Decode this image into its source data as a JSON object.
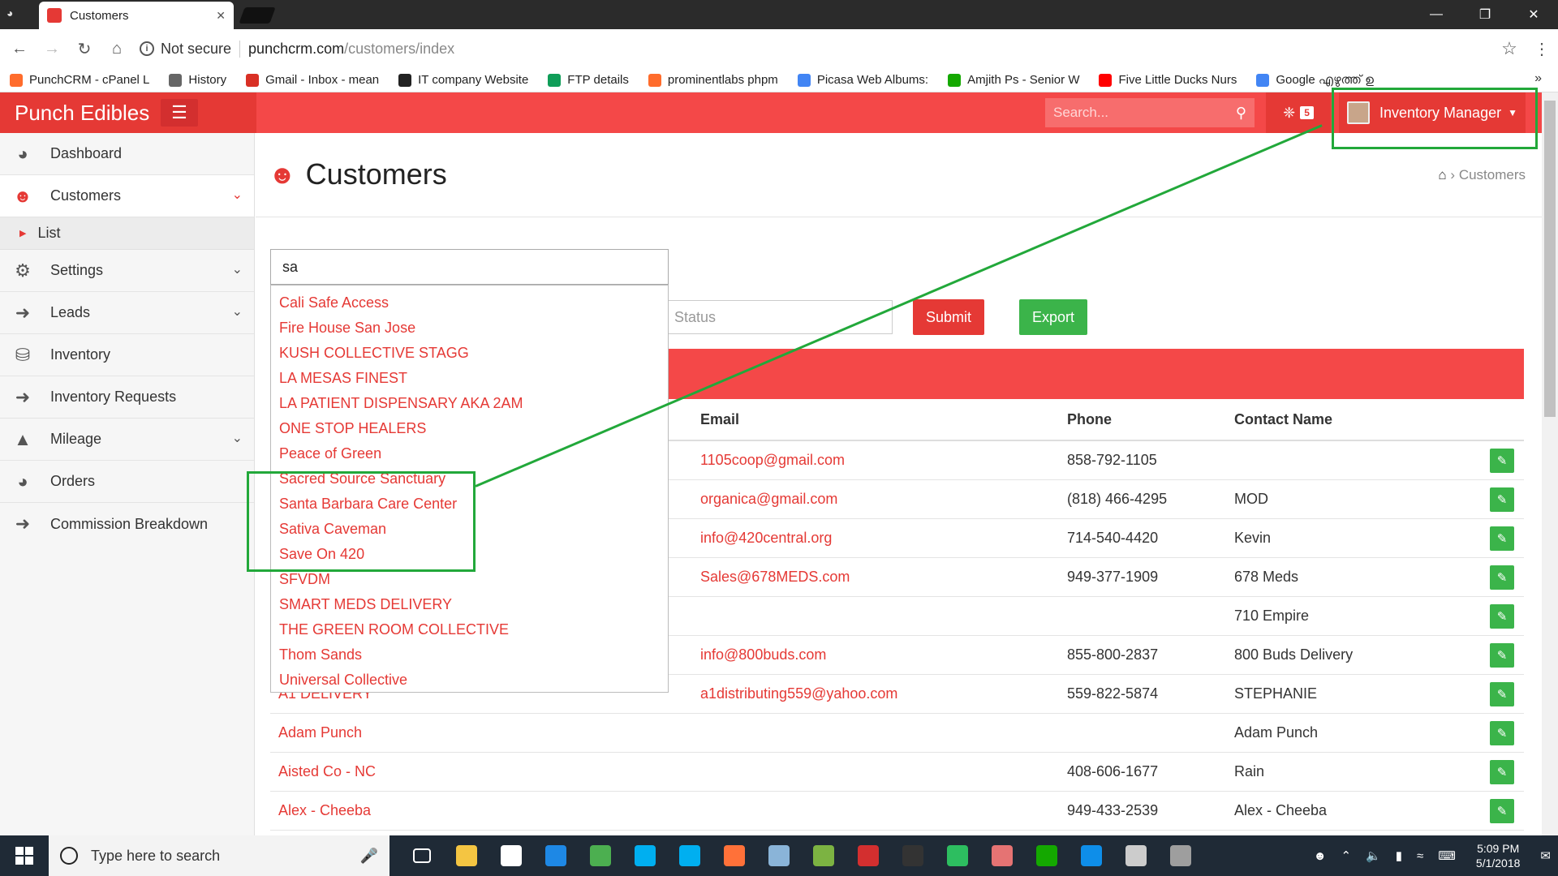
{
  "browser": {
    "tab_title": "Customers",
    "security": "Not secure",
    "url_host": "punchcrm.com",
    "url_path": "/customers/index",
    "bookmarks": [
      {
        "label": "PunchCRM - cPanel L",
        "icon": "cpanel-icon",
        "color": "#ff6c2c"
      },
      {
        "label": "History",
        "icon": "history-icon",
        "color": "#666666"
      },
      {
        "label": "Gmail - Inbox - mean",
        "icon": "gmail-icon",
        "color": "#d93025"
      },
      {
        "label": "IT company Website",
        "icon": "website-icon",
        "color": "#222222"
      },
      {
        "label": "FTP details",
        "icon": "sheets-icon",
        "color": "#0f9d58"
      },
      {
        "label": "prominentlabs phpm",
        "icon": "cpanel-icon",
        "color": "#ff6c2c"
      },
      {
        "label": "Picasa Web Albums:",
        "icon": "google-icon",
        "color": "#4285f4"
      },
      {
        "label": "Amjith Ps - Senior W",
        "icon": "upwork-icon",
        "color": "#14a800"
      },
      {
        "label": "Five Little Ducks Nurs",
        "icon": "youtube-icon",
        "color": "#ff0000"
      },
      {
        "label": "Google എഴുത്ത് ഉ",
        "icon": "google-icon",
        "color": "#4285f4"
      }
    ]
  },
  "app": {
    "brand": "Punch Edibles",
    "search_placeholder": "Search...",
    "feed_count": "5",
    "user_label": "Inventory Manager",
    "colors": {
      "primary": "#f44848",
      "dark": "#e53935",
      "success": "#3bb44a",
      "annotation": "#22a83a"
    }
  },
  "sidebar": {
    "items": [
      {
        "label": "Dashboard",
        "icon": "dashboard-icon"
      },
      {
        "label": "Customers",
        "icon": "customers-icon"
      },
      {
        "label": "List",
        "icon": "caret-right-icon"
      },
      {
        "label": "Settings",
        "icon": "gear-icon"
      },
      {
        "label": "Leads",
        "icon": "arrow-right-icon"
      },
      {
        "label": "Inventory",
        "icon": "database-icon"
      },
      {
        "label": "Inventory Requests",
        "icon": "arrow-right-icon"
      },
      {
        "label": "Mileage",
        "icon": "road-icon"
      },
      {
        "label": "Orders",
        "icon": "dashboard-icon"
      },
      {
        "label": "Commission Breakdown",
        "icon": "arrow-right-icon"
      }
    ]
  },
  "page": {
    "title": "Customers",
    "breadcrumb": "Customers",
    "filter_value": "sa",
    "status_placeholder": "Status",
    "submit_label": "Submit",
    "export_label": "Export"
  },
  "autocomplete": [
    "Cali Safe Access",
    "Fire House San Jose",
    "KUSH COLLECTIVE STAGG",
    "LA MESAS FINEST",
    "LA PATIENT DISPENSARY AKA 2AM",
    "ONE STOP HEALERS",
    "Peace of Green",
    "Sacred Source Sanctuary",
    "Santa Barbara Care Center",
    "Sativa Caveman",
    "Save On 420",
    "SFVDM",
    "SMART MEDS DELIVERY",
    "THE GREEN ROOM COLLECTIVE",
    "Thom Sands",
    "Universal Collective"
  ],
  "table": {
    "headers": {
      "email": "Email",
      "phone": "Phone",
      "contact": "Contact Name"
    },
    "rows": [
      {
        "name": "",
        "email": "1105coop@gmail.com",
        "phone": "858-792-1105",
        "contact": ""
      },
      {
        "name": "",
        "email": "organica@gmail.com",
        "phone": "(818) 466-4295",
        "contact": "MOD"
      },
      {
        "name": "",
        "email": "info@420central.org",
        "phone": "714-540-4420",
        "contact": "Kevin"
      },
      {
        "name": "",
        "email": "Sales@678MEDS.com",
        "phone": "949-377-1909",
        "contact": "678 Meds"
      },
      {
        "name": "",
        "email": "",
        "phone": "",
        "contact": "710 Empire"
      },
      {
        "name": "",
        "email": "info@800buds.com",
        "phone": "855-800-2837",
        "contact": "800 Buds Delivery"
      },
      {
        "name": "A1 DELIVERY",
        "email": "a1distributing559@yahoo.com",
        "phone": "559-822-5874",
        "contact": "STEPHANIE"
      },
      {
        "name": "Adam Punch",
        "email": "",
        "phone": "",
        "contact": "Adam Punch"
      },
      {
        "name": "Aisted Co - NC",
        "email": "",
        "phone": "408-606-1677",
        "contact": "Rain"
      },
      {
        "name": "Alex - Cheeba",
        "email": "",
        "phone": "949-433-2539",
        "contact": "Alex - Cheeba"
      }
    ]
  },
  "taskbar": {
    "search_placeholder": "Type here to search",
    "time": "5:09 PM",
    "date": "5/1/2018",
    "apps": [
      {
        "name": "task-view-icon",
        "color": "#1f2a36"
      },
      {
        "name": "file-explorer-icon",
        "color": "#f4c542"
      },
      {
        "name": "store-icon",
        "color": "#ffffff"
      },
      {
        "name": "edge-icon",
        "color": "#1e88e5"
      },
      {
        "name": "chrome-icon",
        "color": "#4caf50"
      },
      {
        "name": "skype-icon",
        "color": "#00aff0"
      },
      {
        "name": "skype-business-icon",
        "color": "#00aff0"
      },
      {
        "name": "firefox-icon",
        "color": "#ff7139"
      },
      {
        "name": "notepad-icon",
        "color": "#8ab4d8"
      },
      {
        "name": "git-icon",
        "color": "#7cb342"
      },
      {
        "name": "acrobat-icon",
        "color": "#d32f2f"
      },
      {
        "name": "terminal-icon",
        "color": "#333333"
      },
      {
        "name": "evernote-icon",
        "color": "#2dbe60"
      },
      {
        "name": "flash-icon",
        "color": "#e57373"
      },
      {
        "name": "upwork-icon",
        "color": "#14a800"
      },
      {
        "name": "teamviewer-icon",
        "color": "#0e8ee9"
      },
      {
        "name": "paint-icon",
        "color": "#cccccc"
      },
      {
        "name": "paint-3d-icon",
        "color": "#9e9e9e"
      }
    ]
  }
}
